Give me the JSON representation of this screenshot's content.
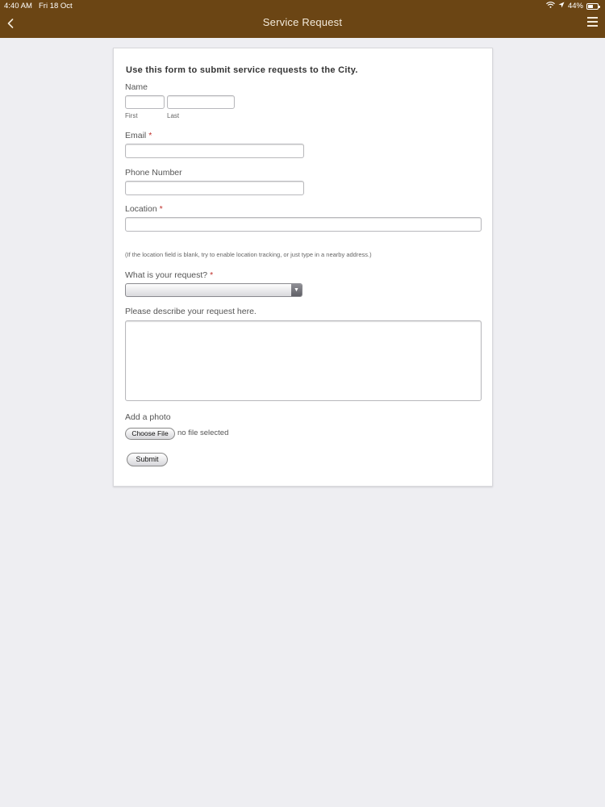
{
  "status_bar": {
    "time": "4:40 AM",
    "date": "Fri 18 Oct",
    "battery": "44%",
    "battery_level": 0.44
  },
  "nav": {
    "title": "Service Request",
    "back_icon": "chevron-left-icon",
    "menu_icon": "hamburger-menu-icon"
  },
  "colors": {
    "nav_bar": "#6b4514",
    "background": "#eeeef2",
    "required_marker": "#c0302b"
  },
  "form": {
    "heading": "Use this form to submit service requests to the City.",
    "name": {
      "label": "Name",
      "first_label": "First",
      "first_value": "",
      "last_label": "Last",
      "last_value": ""
    },
    "email": {
      "label": "Email",
      "required_mark": "*",
      "value": ""
    },
    "phone": {
      "label": "Phone Number",
      "value": ""
    },
    "location": {
      "label": "Location",
      "required_mark": "*",
      "value": "",
      "note": "(If the location field is blank, try to enable location tracking, or just type in a nearby address.)"
    },
    "request_type": {
      "label": "What is your request?",
      "required_mark": "*",
      "selected": ""
    },
    "description": {
      "label": "Please describe your request here.",
      "value": ""
    },
    "photo": {
      "label": "Add a photo",
      "button_label": "Choose File",
      "status": "no file selected"
    },
    "submit_label": "Submit"
  }
}
